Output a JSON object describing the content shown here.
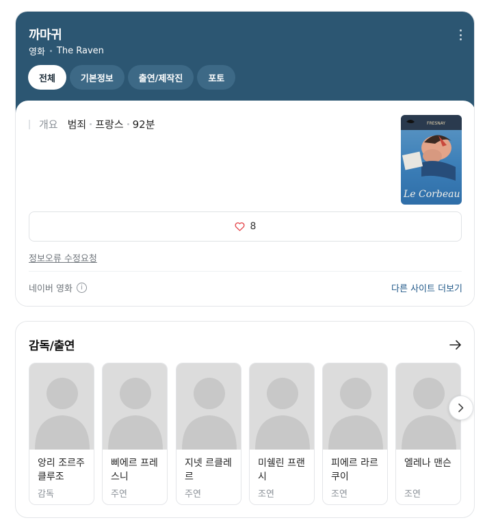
{
  "header": {
    "title": "까마귀",
    "category": "영화",
    "original_title": "The Raven"
  },
  "tabs": [
    {
      "label": "전체",
      "active": true
    },
    {
      "label": "기본정보",
      "active": false
    },
    {
      "label": "출연/제작진",
      "active": false
    },
    {
      "label": "포토",
      "active": false
    }
  ],
  "summary": {
    "label": "개요",
    "genre": "범죄",
    "country": "프랑스",
    "runtime": "92분"
  },
  "poster": {
    "alt": "Le Corbeau poster",
    "text_title": "Le Corbeau",
    "text_actor": "FRESNAY"
  },
  "like": {
    "count": "8",
    "icon": "heart-icon",
    "color": "#e5484d"
  },
  "report_link": "정보오류 수정요청",
  "source": {
    "label": "네이버 영화",
    "info_icon": "ⓘ",
    "more_link": "다른 사이트 더보기"
  },
  "cast_section": {
    "title": "감독/출연",
    "people": [
      {
        "name": "앙리 조르주 클루조",
        "role": "감독"
      },
      {
        "name": "삐에르 프레스니",
        "role": "주연"
      },
      {
        "name": "지넷 르클레르",
        "role": "주연"
      },
      {
        "name": "미쉘린 프랜시",
        "role": "조연"
      },
      {
        "name": "피에르 라르쿠이",
        "role": "조연"
      },
      {
        "name": "엘레나 맨슨",
        "role": "조연"
      }
    ]
  },
  "colors": {
    "header_bg": "#2c5672",
    "tab_bg": "#3d6986",
    "link_blue": "#1f5788"
  }
}
